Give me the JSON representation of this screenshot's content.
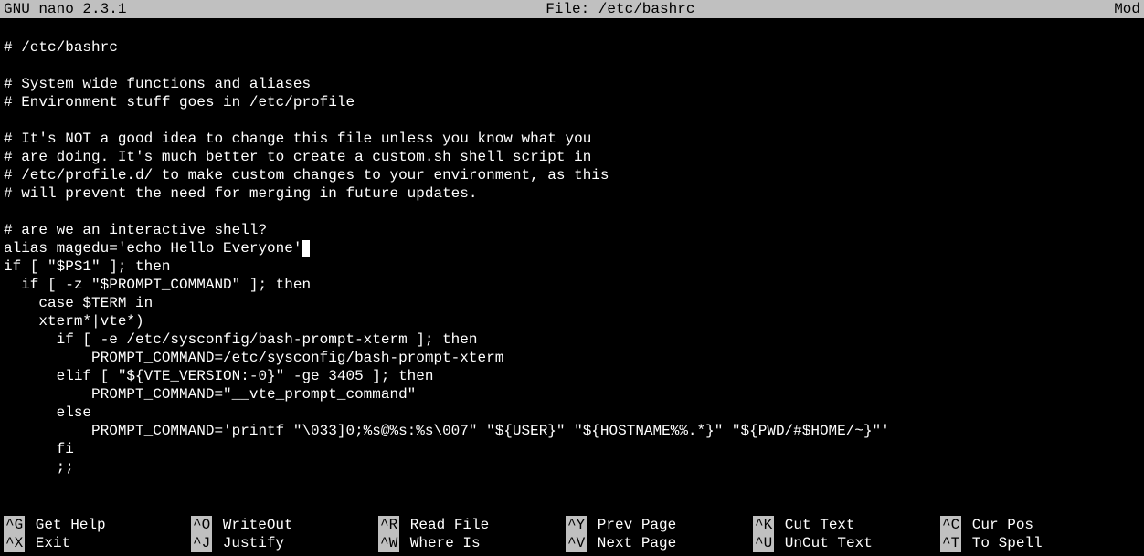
{
  "header": {
    "app_name": "  GNU nano 2.3.1",
    "file_label": "File: /etc/bashrc",
    "status": "Mod"
  },
  "content": {
    "lines": [
      "",
      "# /etc/bashrc",
      "",
      "# System wide functions and aliases",
      "# Environment stuff goes in /etc/profile",
      "",
      "# It's NOT a good idea to change this file unless you know what you",
      "# are doing. It's much better to create a custom.sh shell script in",
      "# /etc/profile.d/ to make custom changes to your environment, as this",
      "# will prevent the need for merging in future updates.",
      "",
      "# are we an interactive shell?",
      "alias magedu='echo Hello Everyone'",
      "if [ \"$PS1\" ]; then",
      "  if [ -z \"$PROMPT_COMMAND\" ]; then",
      "    case $TERM in",
      "    xterm*|vte*)",
      "      if [ -e /etc/sysconfig/bash-prompt-xterm ]; then",
      "          PROMPT_COMMAND=/etc/sysconfig/bash-prompt-xterm",
      "      elif [ \"${VTE_VERSION:-0}\" -ge 3405 ]; then",
      "          PROMPT_COMMAND=\"__vte_prompt_command\"",
      "      else",
      "          PROMPT_COMMAND='printf \"\\033]0;%s@%s:%s\\007\" \"${USER}\" \"${HOSTNAME%%.*}\" \"${PWD/#$HOME/~}\"'",
      "      fi",
      "      ;;"
    ],
    "cursor_line": 12
  },
  "shortcuts": {
    "row1": [
      {
        "key": "^G",
        "label": "Get Help"
      },
      {
        "key": "^O",
        "label": "WriteOut"
      },
      {
        "key": "^R",
        "label": "Read File"
      },
      {
        "key": "^Y",
        "label": "Prev Page"
      },
      {
        "key": "^K",
        "label": "Cut Text"
      },
      {
        "key": "^C",
        "label": "Cur Pos"
      }
    ],
    "row2": [
      {
        "key": "^X",
        "label": "Exit"
      },
      {
        "key": "^J",
        "label": "Justify"
      },
      {
        "key": "^W",
        "label": "Where Is"
      },
      {
        "key": "^V",
        "label": "Next Page"
      },
      {
        "key": "^U",
        "label": "UnCut Text"
      },
      {
        "key": "^T",
        "label": "To Spell"
      }
    ]
  }
}
